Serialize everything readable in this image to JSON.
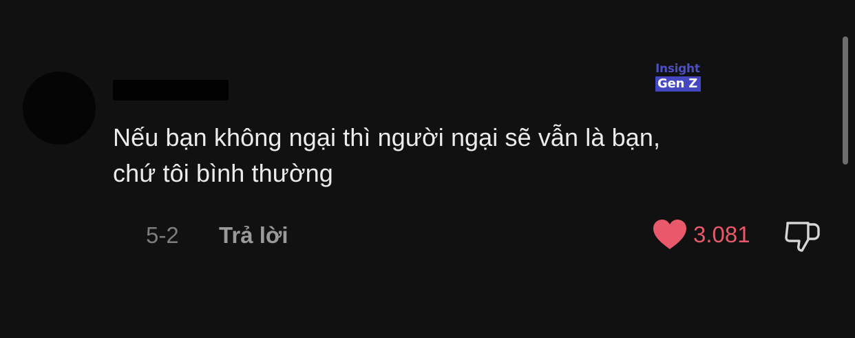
{
  "comment": {
    "text_lines": [
      "Nếu bạn không ngại thì người ngại sẽ vẫn là bạn,",
      "chứ tôi bình thường"
    ],
    "date": "5-2",
    "reply_label": "Trả lời",
    "like_count": "3.081"
  },
  "watermark": {
    "line1": "Insight",
    "line2": "Gen Z"
  },
  "icons": {
    "like": "heart-icon",
    "dislike": "thumbs-down-icon"
  },
  "colors": {
    "background": "#111111",
    "text": "#ececec",
    "muted": "#7d7d7d",
    "like": "#e85a6b",
    "brand": "#4548c0"
  }
}
